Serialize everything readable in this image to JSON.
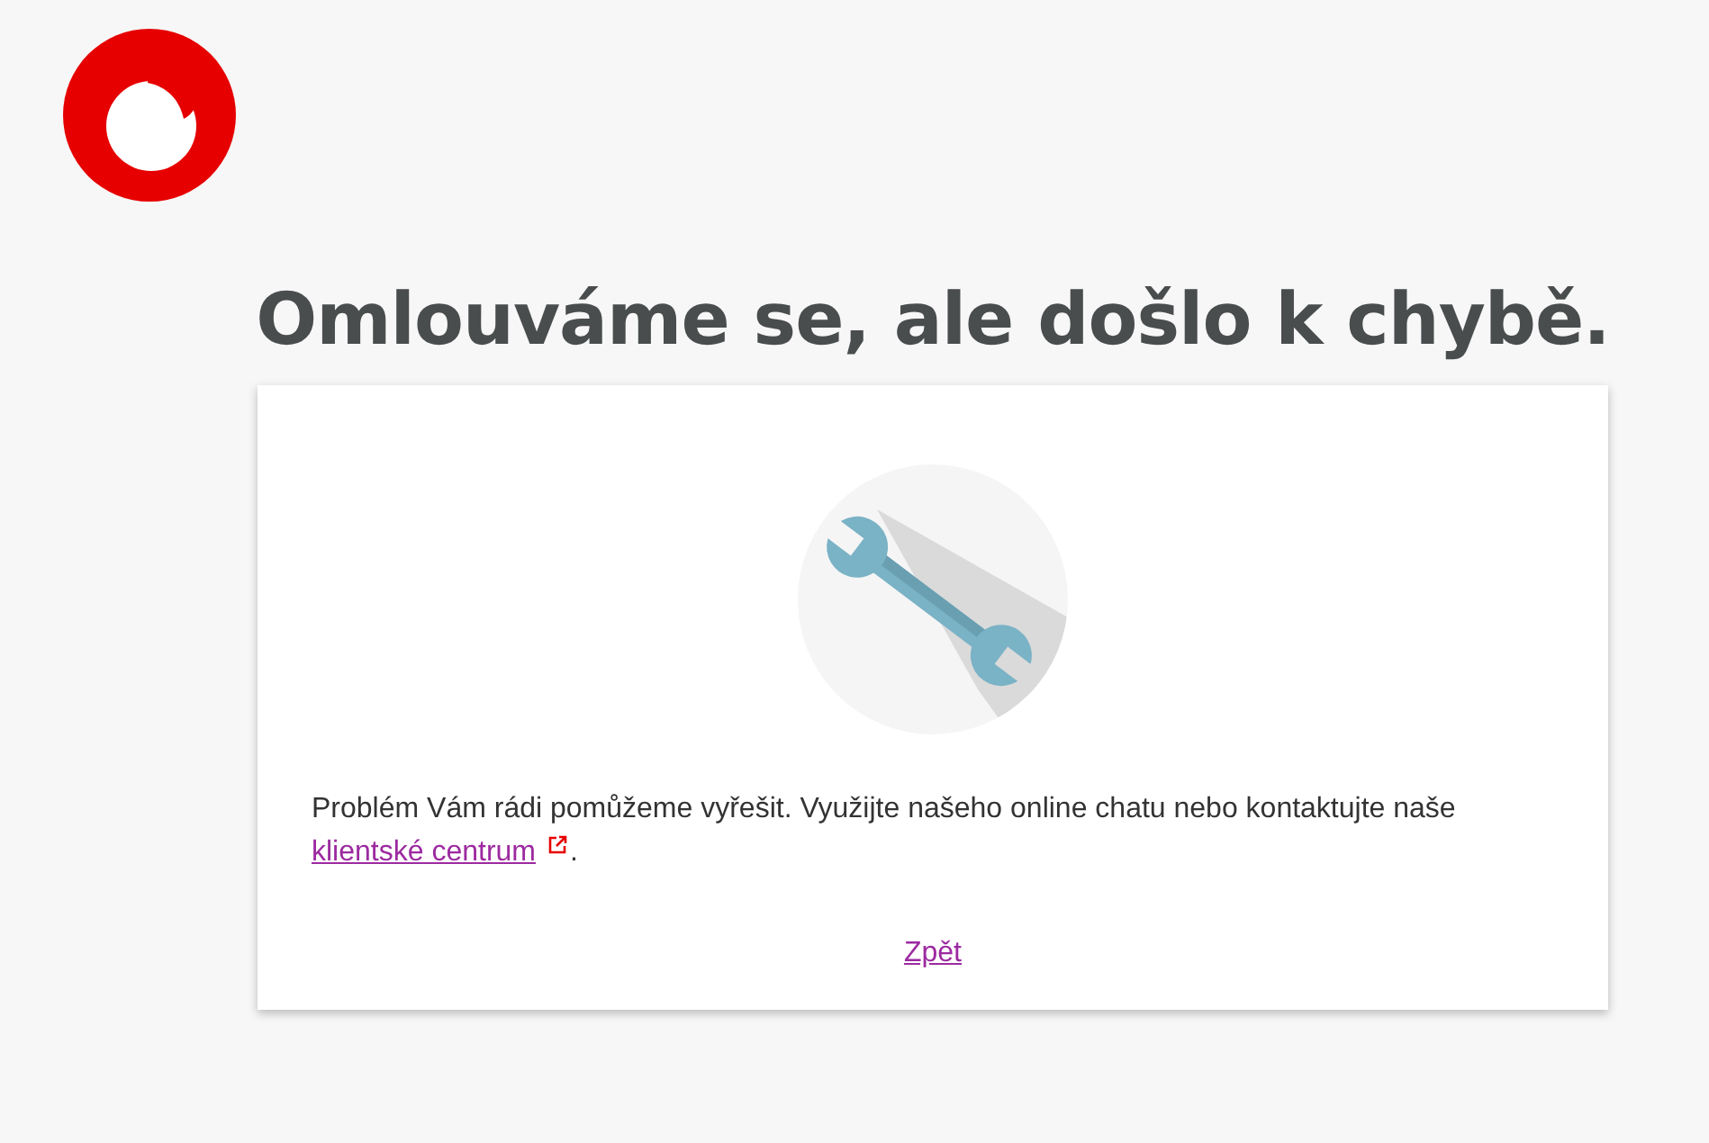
{
  "title": "Omlouváme se, ale došlo k chybě.",
  "message": {
    "text": "Problém Vám rádi pomůžeme vyřešit. Využijte našeho online chatu nebo kontaktujte naše ",
    "link": "klientské centrum",
    "after": "."
  },
  "back_link": "Zpět"
}
